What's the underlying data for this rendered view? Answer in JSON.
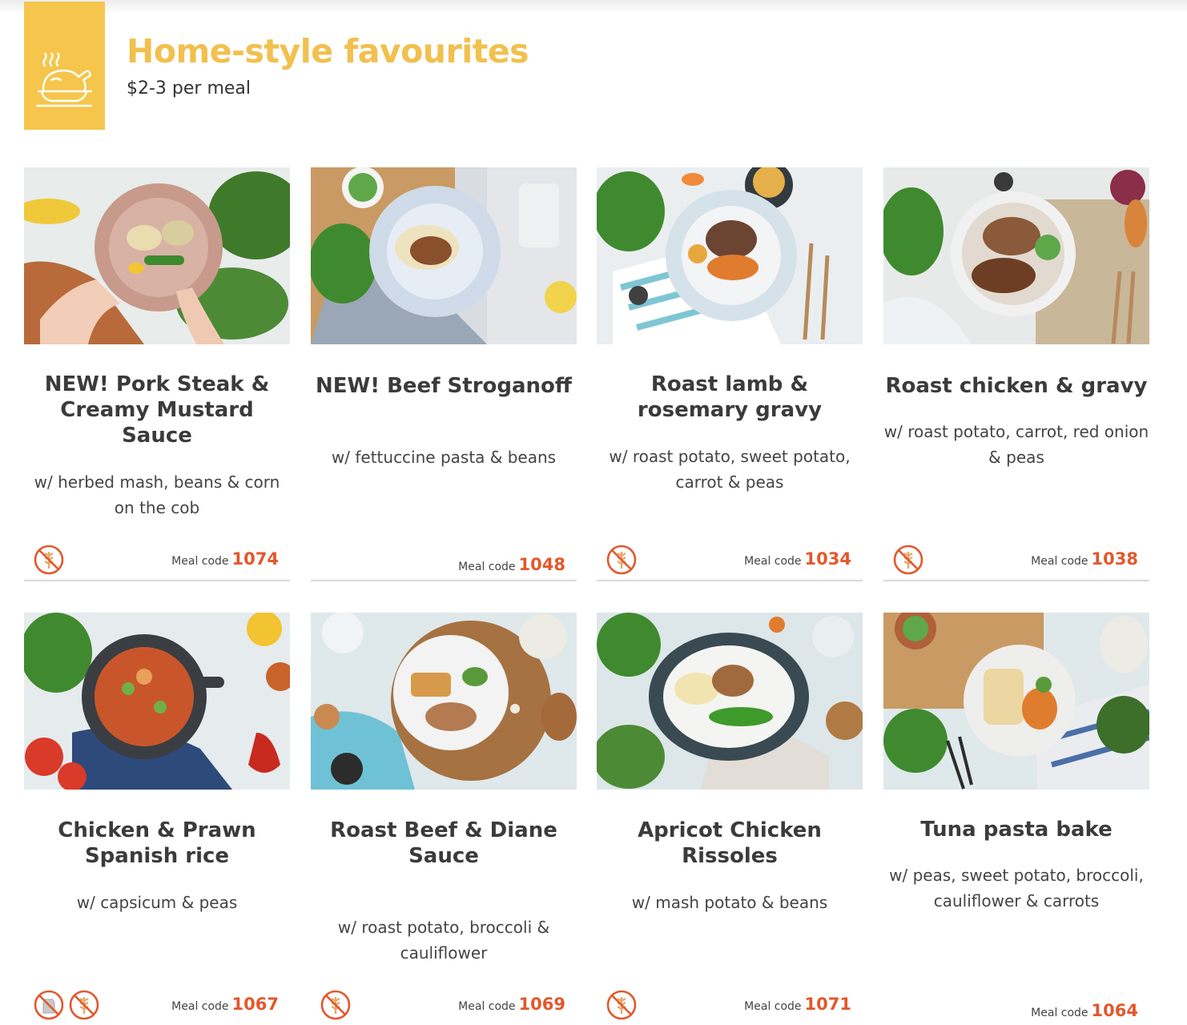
{
  "category": {
    "title": "Home-style favourites",
    "subtitle": "$2-3 per meal",
    "icon": "roast-chicken-icon",
    "accent_color": "#f5c54c"
  },
  "meal_code_label": "Meal code",
  "colors": {
    "code_number": "#e2582c",
    "badge_red": "#e2582c"
  },
  "meals": [
    {
      "name": "NEW! Pork Steak & Creamy Mustard Sauce",
      "description": "w/ herbed mash, beans & corn on the cob",
      "code": "1074",
      "badges": [
        "gluten-free-icon"
      ]
    },
    {
      "name": "NEW! Beef Stroganoff",
      "description": "w/ fettuccine pasta & beans",
      "code": "1048",
      "badges": []
    },
    {
      "name": "Roast lamb & rosemary gravy",
      "description": "w/ roast potato, sweet potato, carrot & peas",
      "code": "1034",
      "badges": [
        "gluten-free-icon"
      ]
    },
    {
      "name": "Roast chicken & gravy",
      "description": "w/ roast potato, carrot, red onion & peas",
      "code": "1038",
      "badges": [
        "gluten-free-icon"
      ]
    },
    {
      "name": "Chicken & Prawn Spanish rice",
      "description": "w/ capsicum & peas",
      "code": "1067",
      "badges": [
        "dairy-free-icon",
        "gluten-free-icon"
      ]
    },
    {
      "name": "Roast Beef & Diane Sauce",
      "description": "w/ roast potato, broccoli & cauliflower",
      "code": "1069",
      "badges": [
        "gluten-free-icon"
      ]
    },
    {
      "name": "Apricot Chicken Rissoles",
      "description": "w/ mash potato & beans",
      "code": "1071",
      "badges": [
        "gluten-free-icon"
      ]
    },
    {
      "name": "Tuna pasta bake",
      "description": "w/ peas, sweet potato, broccoli, cauliflower & carrots",
      "code": "1064",
      "badges": []
    }
  ]
}
